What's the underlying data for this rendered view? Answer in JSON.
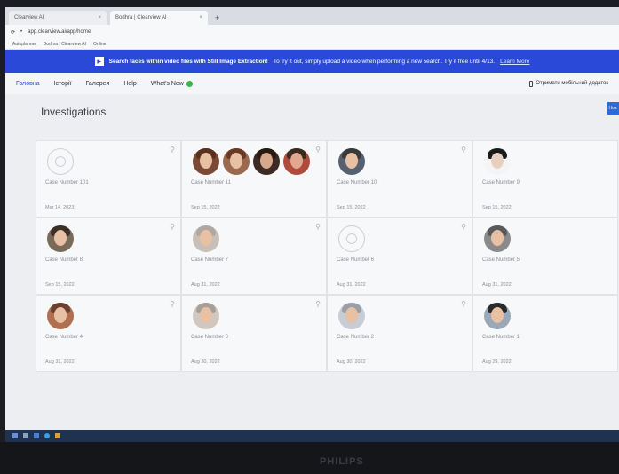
{
  "browser": {
    "tabs": [
      {
        "label": "Clearview AI",
        "active": false
      },
      {
        "label": "Bodhra | Clearview AI",
        "active": true
      }
    ],
    "address": "app.clearview.ai/app/home",
    "bookmarks": [
      "Autoplanner",
      "Bodhra | Clearview AI",
      "Online"
    ]
  },
  "banner": {
    "bold": "Search faces within video files with Still Image Extraction!",
    "text": "To try it out, simply upload a video when performing a new search. Try it free until 4/13.",
    "link": "Learn More"
  },
  "nav": {
    "home": "Головна",
    "history": "Історії",
    "gallery": "Галерея",
    "help": "Help",
    "whats_new": "What's New",
    "mobile": "Отримати мобільний додаток"
  },
  "page": {
    "title": "Investigations",
    "corner_button": "Нов"
  },
  "cards": [
    {
      "case": "Case Number 101",
      "date": "Mar 14, 2023"
    },
    {
      "case": "Case Number 11",
      "date": "Sep 15, 2022"
    },
    {
      "case": "Case Number 10",
      "date": "Sep 15, 2022"
    },
    {
      "case": "Case Number 9",
      "date": "Sep 15, 2022"
    },
    {
      "case": "Case Number 8",
      "date": "Sep 15, 2022"
    },
    {
      "case": "Case Number 7",
      "date": "Aug 31, 2022"
    },
    {
      "case": "Case Number 6",
      "date": "Aug 31, 2022"
    },
    {
      "case": "Case Number 5",
      "date": "Aug 31, 2022"
    },
    {
      "case": "Case Number 4",
      "date": "Aug 31, 2022"
    },
    {
      "case": "Case Number 3",
      "date": "Aug 30, 2022"
    },
    {
      "case": "Case Number 2",
      "date": "Aug 30, 2022"
    },
    {
      "case": "Case Number 1",
      "date": "Aug 29, 2022"
    }
  ],
  "monitor": {
    "brand": "PHILIPS"
  },
  "colors": {
    "accent": "#2a49d9",
    "new_dot": "#3cb54a"
  }
}
